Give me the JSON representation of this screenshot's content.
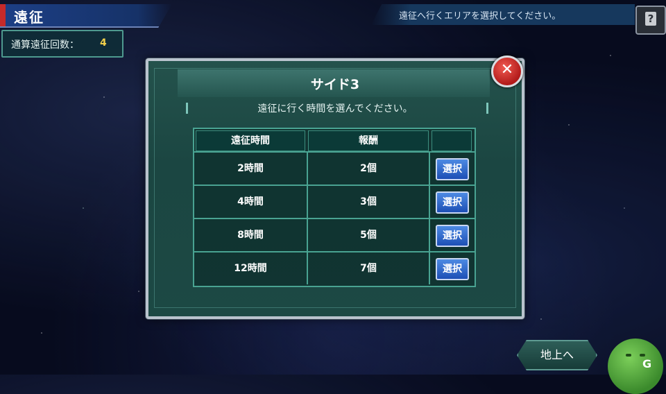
{
  "header": {
    "title": "遠征",
    "count_label": "通算遠征回数：",
    "count_value": "4",
    "info_text": "遠征へ行くエリアを選択してください。",
    "help_label": "?"
  },
  "dialog": {
    "title": "サイド3",
    "subtitle": "遠征に行く時間を選んでください。",
    "close_label": "✕",
    "columns": [
      "遠征時間",
      "報酬",
      ""
    ],
    "rows": [
      {
        "time": "2時間",
        "reward": "2個",
        "button": "選択"
      },
      {
        "time": "4時間",
        "reward": "3個",
        "button": "選択"
      },
      {
        "time": "8時間",
        "reward": "5個",
        "button": "選択"
      },
      {
        "time": "12時間",
        "reward": "7個",
        "button": "選択"
      }
    ]
  },
  "footer": {
    "ground_button": "地上へ",
    "corner_mark": "G"
  },
  "colors": {
    "panel": "#1b4642",
    "accent_red": "#c62a2a",
    "select_blue": "#1d4fb5",
    "count_gold": "#f2d04a"
  }
}
